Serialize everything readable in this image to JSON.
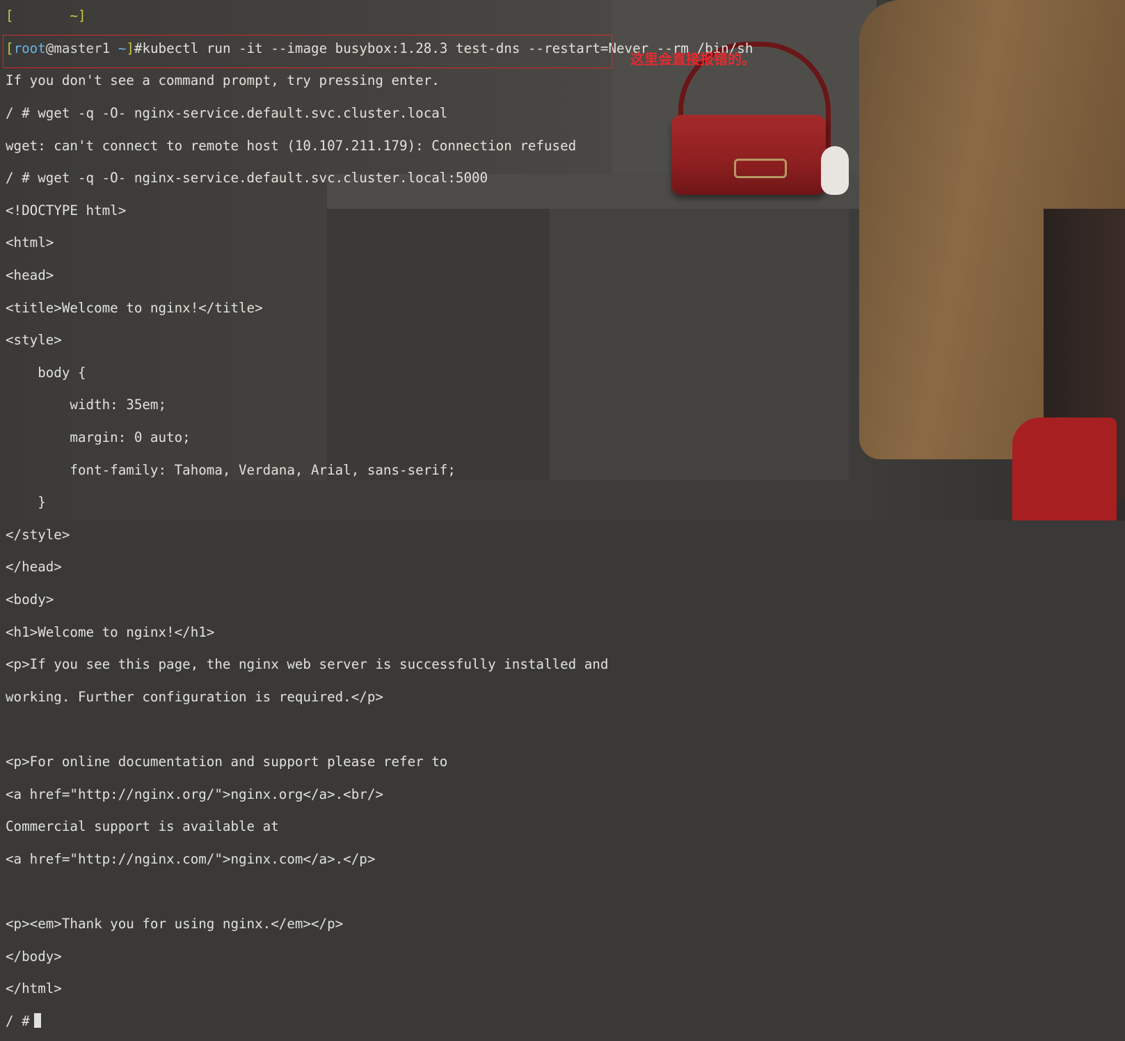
{
  "terminal": {
    "partial_top_line": "[       ~]",
    "prompt": {
      "open": "[",
      "user": "root",
      "at": "@",
      "host": "master1",
      "tilde": " ~",
      "close": "]"
    },
    "command": "#kubectl run -it --image busybox:1.28.3 test-dns --restart=Never --rm /bin/sh",
    "lines": [
      "If you don't see a command prompt, try pressing enter.",
      "/ # wget -q -O- nginx-service.default.svc.cluster.local",
      "wget: can't connect to remote host (10.107.211.179): Connection refused",
      "/ # wget -q -O- nginx-service.default.svc.cluster.local:5000",
      "<!DOCTYPE html>",
      "<html>",
      "<head>",
      "<title>Welcome to nginx!</title>",
      "<style>",
      "    body {",
      "        width: 35em;",
      "        margin: 0 auto;",
      "        font-family: Tahoma, Verdana, Arial, sans-serif;",
      "    }",
      "</style>",
      "</head>",
      "<body>",
      "<h1>Welcome to nginx!</h1>",
      "<p>If you see this page, the nginx web server is successfully installed and",
      "working. Further configuration is required.</p>",
      "",
      "<p>For online documentation and support please refer to",
      "<a href=\"http://nginx.org/\">nginx.org</a>.<br/>",
      "Commercial support is available at",
      "<a href=\"http://nginx.com/\">nginx.com</a>.</p>",
      "",
      "<p><em>Thank you for using nginx.</em></p>",
      "</body>",
      "</html>"
    ],
    "final_prompt": "/ #"
  },
  "annotation": {
    "text": "这里会直接报错的。",
    "color": "#e52a2f"
  },
  "colors": {
    "text": "#e2e2dc",
    "prompt_bracket": "#c9c943",
    "prompt_user": "#66b4e6",
    "highlight": "#d9262a"
  },
  "icons": {
    "cursor": "block-cursor-icon"
  }
}
